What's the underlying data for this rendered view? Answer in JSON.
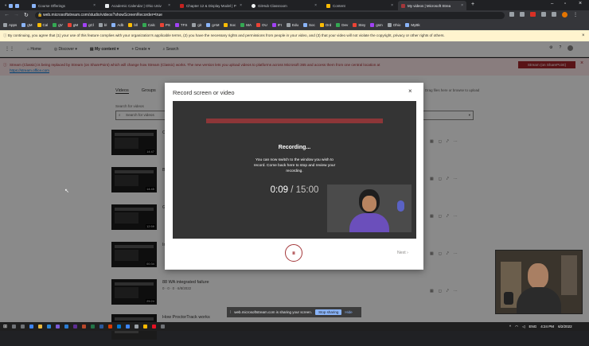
{
  "browser": {
    "tabs": [
      {
        "label": "Course Offerings",
        "color": "#8ab4f8",
        "active": false
      },
      {
        "label": "Academic Calendar | Ohio Univ",
        "color": "#e8eaed",
        "active": false
      },
      {
        "label": "Chapter 12 & Display Model | P",
        "color": "#c5221f",
        "active": false
      },
      {
        "label": "GitHub Classroom",
        "color": "#f1f3f4",
        "active": false
      },
      {
        "label": "Content",
        "color": "#fbbc04",
        "active": false
      },
      {
        "label": "My videos | Microsoft Strea",
        "color": "#a4373a",
        "active": true
      }
    ],
    "url": "web.microsoftstream.com/studio/videos?showScreenRecorder=true",
    "bookmarks": [
      "Apps",
      "gM",
      "Cal",
      "gV",
      "gM",
      "gCl",
      "bl",
      "Adb",
      "bll",
      "Calc",
      "PS",
      "TFS",
      "git",
      "gAM",
      "Soc",
      "MA",
      "OU",
      "IFI",
      "Edu",
      "Soc",
      "Ord",
      "Dev",
      "Stey",
      "gsm",
      "Ohio",
      "MyBk"
    ]
  },
  "consent_text": "By continuing, you agree that (1) your use of this feature complies with your organization's applicable terms, (2) you have the necessary rights and permissions from people in your video, and (3) that your video will not violate the copyright, privacy or other rights of others.",
  "stream_nav": {
    "home": "Home",
    "discover": "Discover",
    "my_content": "My content",
    "create": "Create",
    "search": "Search"
  },
  "notice": {
    "text": "Stream (Classic) is being replaced by Stream (on SharePoint) which will change how Stream (Classic) works. The new version lets you upload videos to platforms across Microsoft 365 and access them from one central location at",
    "link": "https://stream.office.com",
    "button": "Stream (on SharePoint)"
  },
  "my_content": {
    "tabs": [
      "Videos",
      "Groups"
    ],
    "search_label": "Search for videos",
    "search_placeholder": "Search for videos",
    "upload_hint": "Drag files here or browse to upload"
  },
  "videos": [
    {
      "title": "C",
      "duration": "14:47",
      "meta": ""
    },
    {
      "title": "B",
      "duration": "14:45",
      "meta": ""
    },
    {
      "title": "G",
      "duration": "12:59",
      "meta": ""
    },
    {
      "title": "In",
      "duration": "00:34",
      "meta": ""
    },
    {
      "title": "88 WA integrated failure",
      "duration": "25:24",
      "meta": "0 · 0 · 0 · 6/8/2022"
    },
    {
      "title": "How ProctorTrack works",
      "duration": "",
      "meta": ""
    }
  ],
  "modal": {
    "title": "Record screen or video",
    "recording": "Recording...",
    "message": "You can now switch to the window you wish to record. Come back here to stop and review your recording.",
    "elapsed": "0:09",
    "separator": "/",
    "limit": "15:00",
    "next": "Next"
  },
  "share_bar": {
    "text": "web.microsoftstream.com is sharing your screen.",
    "stop": "Stop sharing",
    "hide": "Hide"
  },
  "taskbar": {
    "lang": "ENG",
    "time": "4:24 PM",
    "date": "6/2/2022"
  }
}
